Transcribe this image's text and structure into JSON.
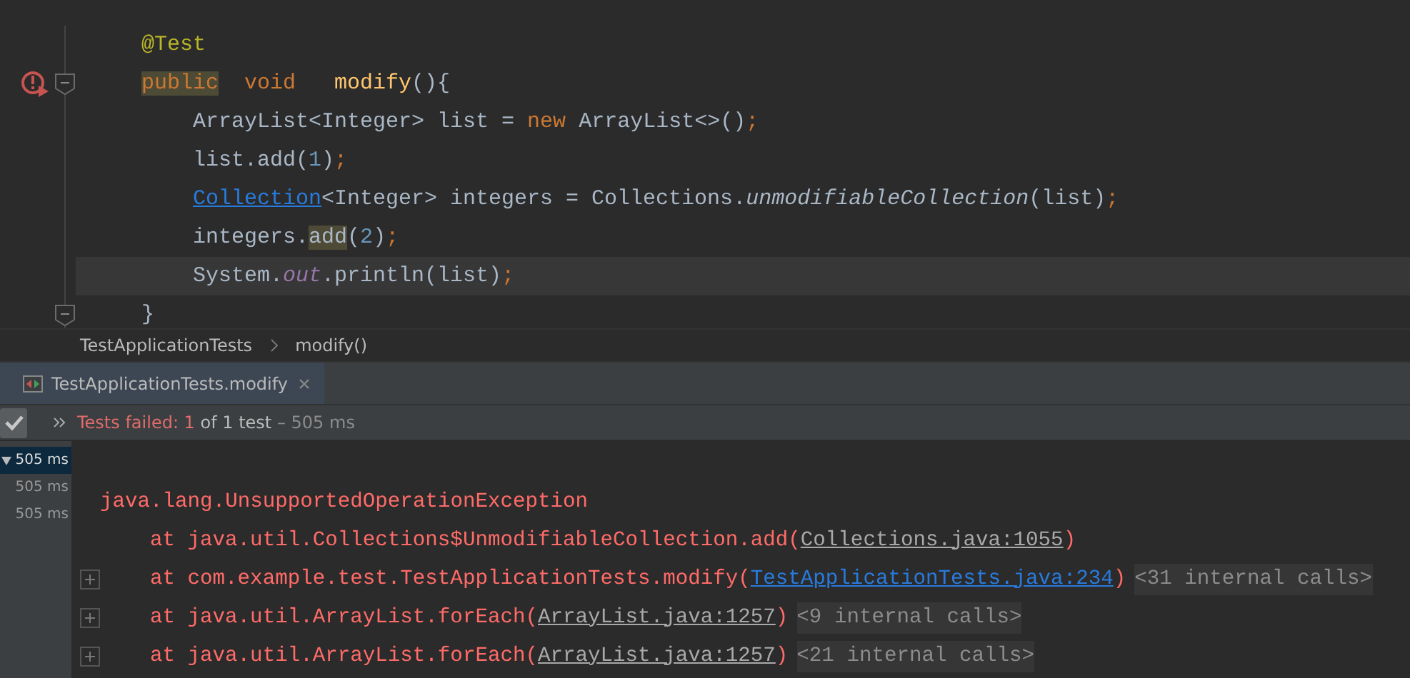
{
  "editor": {
    "lines": [
      {
        "current": false,
        "test_failed": false,
        "foldable": false,
        "indented": false,
        "tokens": [
          {
            "text": "@Test",
            "kind": "annotation",
            "highlighted": false
          }
        ]
      },
      {
        "current": false,
        "test_failed": true,
        "foldable": true,
        "indented": false,
        "tokens": [
          {
            "text": "public",
            "kind": "keyword",
            "highlighted": true
          },
          {
            "text": "  void   ",
            "kind": "keyword",
            "highlighted": false
          },
          {
            "text": "modify",
            "kind": "method",
            "highlighted": false
          },
          {
            "text": "(){",
            "kind": "plain",
            "highlighted": false
          }
        ]
      },
      {
        "current": false,
        "test_failed": false,
        "foldable": false,
        "indented": true,
        "tokens": [
          {
            "text": "ArrayList<Integer> list = ",
            "kind": "plain",
            "highlighted": false
          },
          {
            "text": "new ",
            "kind": "keyword",
            "highlighted": false
          },
          {
            "text": "ArrayList<>()",
            "kind": "plain",
            "highlighted": false
          },
          {
            "text": ";",
            "kind": "keyword",
            "highlighted": false
          }
        ]
      },
      {
        "current": false,
        "test_failed": false,
        "foldable": false,
        "indented": true,
        "tokens": [
          {
            "text": "list.add(",
            "kind": "plain",
            "highlighted": false
          },
          {
            "text": "1",
            "kind": "number",
            "highlighted": false
          },
          {
            "text": ")",
            "kind": "plain",
            "highlighted": false
          },
          {
            "text": ";",
            "kind": "keyword",
            "highlighted": false
          }
        ]
      },
      {
        "current": false,
        "test_failed": false,
        "foldable": false,
        "indented": true,
        "tokens": [
          {
            "text": "Collection",
            "kind": "link",
            "highlighted": false
          },
          {
            "text": "<Integer> integers = Collections.",
            "kind": "plain",
            "highlighted": false
          },
          {
            "text": "unmodifiableCollection",
            "kind": "static",
            "highlighted": false
          },
          {
            "text": "(list)",
            "kind": "plain",
            "highlighted": false
          },
          {
            "text": ";",
            "kind": "keyword",
            "highlighted": false
          }
        ]
      },
      {
        "current": false,
        "test_failed": false,
        "foldable": false,
        "indented": true,
        "tokens": [
          {
            "text": "integers.",
            "kind": "plain",
            "highlighted": false
          },
          {
            "text": "add",
            "kind": "plain",
            "highlighted": true
          },
          {
            "text": "(",
            "kind": "plain",
            "highlighted": false
          },
          {
            "text": "2",
            "kind": "number",
            "highlighted": false
          },
          {
            "text": ")",
            "kind": "plain",
            "highlighted": false
          },
          {
            "text": ";",
            "kind": "keyword",
            "highlighted": false
          }
        ]
      },
      {
        "current": true,
        "test_failed": false,
        "foldable": false,
        "indented": true,
        "tokens": [
          {
            "text": "System.",
            "kind": "plain",
            "highlighted": false
          },
          {
            "text": "out",
            "kind": "field",
            "highlighted": false
          },
          {
            "text": ".println(list)",
            "kind": "plain",
            "highlighted": false
          },
          {
            "text": ";",
            "kind": "keyword",
            "highlighted": false
          }
        ]
      },
      {
        "current": false,
        "test_failed": false,
        "foldable": true,
        "indented": false,
        "tokens": [
          {
            "text": "}",
            "kind": "plain",
            "highlighted": false
          }
        ]
      }
    ]
  },
  "breadcrumb": [
    "TestApplicationTests",
    "modify()"
  ],
  "run_tab": {
    "title": "TestApplicationTests.modify",
    "selected": true
  },
  "test_status": {
    "failed": "Tests failed: 1",
    "summary": " of 1 test",
    "duration": "– 505 ms"
  },
  "test_tree": [
    {
      "time": "505 ms",
      "selected": true
    },
    {
      "time": "505 ms",
      "selected": false
    },
    {
      "time": "505 ms",
      "selected": false
    }
  ],
  "console": [
    {
      "expandable": false,
      "indent": false,
      "parts": [
        {
          "text": "java.lang.UnsupportedOperationException",
          "kind": "error"
        }
      ]
    },
    {
      "expandable": false,
      "indent": true,
      "parts": [
        {
          "text": "at java.util.Collections$UnmodifiableCollection.add(",
          "kind": "error"
        },
        {
          "text": "Collections.java:1055",
          "kind": "source"
        },
        {
          "text": ")",
          "kind": "error"
        }
      ]
    },
    {
      "expandable": true,
      "indent": true,
      "parts": [
        {
          "text": "at com.example.test.TestApplicationTests.modify(",
          "kind": "error"
        },
        {
          "text": "TestApplicationTests.java:234",
          "kind": "project-source"
        },
        {
          "text": ")",
          "kind": "error"
        },
        {
          "text": "<31 internal calls>",
          "kind": "internal"
        }
      ]
    },
    {
      "expandable": true,
      "indent": true,
      "parts": [
        {
          "text": "at java.util.ArrayList.forEach(",
          "kind": "error"
        },
        {
          "text": "ArrayList.java:1257",
          "kind": "source"
        },
        {
          "text": ")",
          "kind": "error"
        },
        {
          "text": "<9 internal calls>",
          "kind": "internal"
        }
      ]
    },
    {
      "expandable": true,
      "indent": true,
      "parts": [
        {
          "text": "at java.util.ArrayList.forEach(",
          "kind": "error"
        },
        {
          "text": "ArrayList.java:1257",
          "kind": "source"
        },
        {
          "text": ")",
          "kind": "error"
        },
        {
          "text": "<21 internal calls>",
          "kind": "internal"
        }
      ]
    }
  ]
}
